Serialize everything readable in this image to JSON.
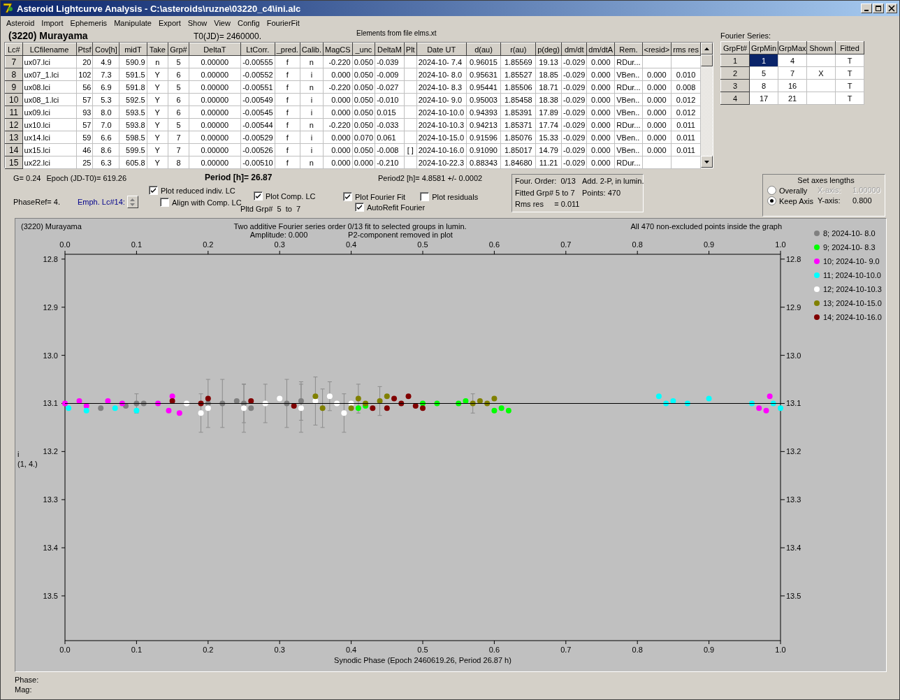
{
  "window": {
    "title": "Asteroid Lightcurve Analysis - C:\\asteroids\\ruzne\\03220_c4\\ini.alc"
  },
  "menu": [
    "Asteroid",
    "Import",
    "Ephemeris",
    "Manipulate",
    "Export",
    "Show",
    "View",
    "Config",
    "FourierFit"
  ],
  "header": {
    "asteroid": "(3220) Murayama",
    "t0": "T0(JD)= 2460000.",
    "elements": "Elements from file elms.xt"
  },
  "lc_table": {
    "columns": [
      "Lc#",
      "LCfilename",
      "Ptsf",
      "Cov[h]",
      "midT",
      "Take",
      "Grp#",
      "DeltaT",
      "LtCorr.",
      "_pred.",
      "Calib.",
      "MagCS",
      "_unc",
      "DeltaM",
      "Plt",
      "Date UT",
      "d(au)",
      "r(au)",
      "p(deg)",
      "dm/dt",
      "dm/dtA",
      "Rem.",
      "<resid>",
      "rms res"
    ],
    "rows": [
      {
        "cells": [
          "7",
          "ux07.lci",
          "20",
          "4.9",
          "590.9",
          "n",
          "5",
          "0.00000",
          "-0.00555",
          "f",
          "n",
          "-0.220",
          "0.050",
          "-0.039",
          null,
          "2024-10- 7.4",
          "0.96015",
          "1.85569",
          "19.13",
          "-0.029",
          "0.000",
          "RDur...",
          null,
          null
        ]
      },
      {
        "cells": [
          "8",
          "ux07_1.lci",
          "102",
          "7.3",
          "591.5",
          "Y",
          "6",
          "0.00000",
          "-0.00552",
          "f",
          "i",
          "0.000",
          "0.050",
          "-0.009",
          null,
          "2024-10- 8.0",
          "0.95631",
          "1.85527",
          "18.85",
          "-0.029",
          "0.000",
          "VBen..",
          "0.000",
          "0.010"
        ]
      },
      {
        "cells": [
          "9",
          "ux08.lci",
          "56",
          "6.9",
          "591.8",
          "Y",
          "5",
          "0.00000",
          "-0.00551",
          "f",
          "n",
          "-0.220",
          "0.050",
          "-0.027",
          null,
          "2024-10- 8.3",
          "0.95441",
          "1.85506",
          "18.71",
          "-0.029",
          "0.000",
          "RDur...",
          "0.000",
          "0.008"
        ]
      },
      {
        "cells": [
          "10",
          "ux08_1.lci",
          "57",
          "5.3",
          "592.5",
          "Y",
          "6",
          "0.00000",
          "-0.00549",
          "f",
          "i",
          "0.000",
          "0.050",
          "-0.010",
          null,
          "2024-10- 9.0",
          "0.95003",
          "1.85458",
          "18.38",
          "-0.029",
          "0.000",
          "VBen..",
          "0.000",
          "0.012"
        ]
      },
      {
        "cells": [
          "11",
          "ux09.lci",
          "93",
          "8.0",
          "593.5",
          "Y",
          "6",
          "0.00000",
          "-0.00545",
          "f",
          "i",
          "0.000",
          "0.050",
          "0.015",
          null,
          "2024-10-10.0",
          "0.94393",
          "1.85391",
          "17.89",
          "-0.029",
          "0.000",
          "VBen..",
          "0.000",
          "0.012"
        ]
      },
      {
        "cells": [
          "12",
          "ux10.lci",
          "57",
          "7.0",
          "593.8",
          "Y",
          "5",
          "0.00000",
          "-0.00544",
          "f",
          "n",
          "-0.220",
          "0.050",
          "-0.033",
          null,
          "2024-10-10.3",
          "0.94213",
          "1.85371",
          "17.74",
          "-0.029",
          "0.000",
          "RDur...",
          "0.000",
          "0.011"
        ]
      },
      {
        "cells": [
          "13",
          "ux14.lci",
          "59",
          "6.6",
          "598.5",
          "Y",
          "7",
          "0.00000",
          "-0.00529",
          "f",
          "i",
          "0.000",
          "0.070",
          "0.061",
          null,
          "2024-10-15.0",
          "0.91596",
          "1.85076",
          "15.33",
          "-0.029",
          "0.000",
          "VBen..",
          "0.000",
          "0.011"
        ]
      },
      {
        "cells": [
          "14",
          "ux15.lci",
          "46",
          "8.6",
          "599.5",
          "Y",
          "7",
          "0.00000",
          "-0.00526",
          "f",
          "i",
          "0.000",
          "0.050",
          "-0.008",
          "[ ]",
          "2024-10-16.0",
          "0.91090",
          "1.85017",
          "14.79",
          "-0.029",
          "0.000",
          "VBen..",
          "0.000",
          "0.011"
        ]
      },
      {
        "cells": [
          "15",
          "ux22.lci",
          "25",
          "6.3",
          "605.8",
          "Y",
          "8",
          "0.00000",
          "-0.00510",
          "f",
          "n",
          "0.000",
          "0.000",
          "-0.210",
          null,
          "2024-10-22.3",
          "0.88343",
          "1.84680",
          "11.21",
          "-0.029",
          "0.000",
          "RDur...",
          null,
          null
        ]
      }
    ]
  },
  "fourier": {
    "label": "Fourier Series:",
    "columns": [
      "GrpFt#",
      "GrpMin",
      "GrpMax",
      "Shown",
      "Fitted"
    ],
    "rows": [
      {
        "cells": [
          "1",
          "1",
          "4",
          null,
          "T"
        ],
        "selected": true
      },
      {
        "cells": [
          "2",
          "5",
          "7",
          "X",
          "T"
        ],
        "selected": false
      },
      {
        "cells": [
          "3",
          "8",
          "16",
          null,
          "T"
        ],
        "selected": false
      },
      {
        "cells": [
          "4",
          "17",
          "21",
          null,
          "T"
        ],
        "selected": false
      }
    ]
  },
  "info": {
    "g": "G= 0.24",
    "epoch": "Epoch (JD-T0)= 619.26",
    "phase_ref": "PhaseRef= 4.",
    "emph": "Emph. Lc#14:",
    "period": "Period [h]= 26.87",
    "period2": "Period2 [h]= 4.8581 +/- 0.0002",
    "plotted_groups": "Pltd Grp#  5  to  7"
  },
  "options": [
    {
      "label": "Plot reduced indiv. LC",
      "checked": true
    },
    {
      "label": "Align with Comp. LC",
      "checked": false
    },
    {
      "label": "Plot Comp. LC",
      "checked": true
    },
    {
      "label": "Plot Fourier Fit",
      "checked": true
    },
    {
      "label": "Plot residuals",
      "checked": false
    },
    {
      "label": "AutoRefit Fourier",
      "checked": true
    }
  ],
  "fit_summary": [
    "Four. Order:  0/13",
    "Add. 2-P, in lumin.",
    "Fitted Grp# 5 to 7",
    "Points: 470",
    "Rms res     = 0.011"
  ],
  "axes_lengths": {
    "title": "Set axes lengths",
    "modes": [
      {
        "label": "Overally",
        "selected": false
      },
      {
        "label": "Keep Axis",
        "selected": true
      }
    ],
    "fields": [
      {
        "label": "X-axis:",
        "value": "1.00000",
        "disabled": true
      },
      {
        "label": "Y-axis:",
        "value": "0.800",
        "disabled": false
      }
    ]
  },
  "plot": {
    "object": "(3220) Murayama",
    "subtitle": "Two additive Fourier series order 0/13 fit to selected groups in lumin.",
    "amplitude": "Amplitude: 0.000",
    "note": "P2-component removed in plot",
    "points_note": "All 470 non-excluded points inside the graph",
    "band": "i",
    "y_scale": "(1, 4.)",
    "chart_data": {
      "type": "scatter",
      "xlabel": "Synodic Phase (Epoch 2460619.26, Period 26.87 h)",
      "xlim": [
        0,
        1
      ],
      "ylim": [
        13.593,
        12.79
      ],
      "xticks": [
        {
          "value": 0,
          "label": "0.0"
        },
        {
          "value": 0.1,
          "label": "0.1"
        },
        {
          "value": 0.2,
          "label": "0.2"
        },
        {
          "value": 0.3,
          "label": "0.3"
        },
        {
          "value": 0.4,
          "label": "0.4"
        },
        {
          "value": 0.5,
          "label": "0.5"
        },
        {
          "value": 0.6,
          "label": "0.6"
        },
        {
          "value": 0.7,
          "label": "0.7"
        },
        {
          "value": 0.8,
          "label": "0.8"
        },
        {
          "value": 0.9,
          "label": "0.9"
        },
        {
          "value": 1,
          "label": "1.0"
        }
      ],
      "yticks": [
        {
          "value": 12.8,
          "label": "12.8"
        },
        {
          "value": 12.9,
          "label": "12.9"
        },
        {
          "value": 13,
          "label": "13.0"
        },
        {
          "value": 13.1,
          "label": "13.1"
        },
        {
          "value": 13.2,
          "label": "13.2"
        },
        {
          "value": 13.3,
          "label": "13.3"
        },
        {
          "value": 13.4,
          "label": "13.4"
        },
        {
          "value": 13.5,
          "label": "13.5"
        }
      ],
      "ref_lines": [
        {
          "axis": "y",
          "value": 13.1
        }
      ],
      "legend": "right",
      "series": [
        {
          "name": "8; 2024-10- 8.0",
          "color": "#808080",
          "x": [
            0.05,
            0.085,
            0.1,
            0.11,
            0.2,
            0.22,
            0.24,
            0.25,
            0.26,
            0.31,
            0.33
          ],
          "values": [
            13.11,
            13.105,
            13.1,
            13.1,
            13.1,
            13.1,
            13.095,
            13.1,
            13.11,
            13.1,
            13.095
          ],
          "errors": [
            null,
            null,
            0.02,
            null,
            0.05,
            0.05,
            null,
            0.04,
            null,
            0.05,
            0.04
          ]
        },
        {
          "name": "9; 2024-10- 8.3",
          "color": "#00ff00",
          "x": [
            0.41,
            0.42,
            0.5,
            0.52,
            0.55,
            0.56,
            0.6,
            0.61,
            0.62
          ],
          "values": [
            13.11,
            13.105,
            13.1,
            13.1,
            13.1,
            13.095,
            13.115,
            13.11,
            13.115
          ]
        },
        {
          "name": "10; 2024-10- 9.0",
          "color": "#ff00ff",
          "x": [
            0,
            0.02,
            0.03,
            0.06,
            0.08,
            0.13,
            0.145,
            0.15,
            0.16,
            0.97,
            0.98,
            0.985
          ],
          "values": [
            13.1,
            13.095,
            13.105,
            13.095,
            13.1,
            13.1,
            13.115,
            13.085,
            13.12,
            13.11,
            13.115,
            13.085
          ]
        },
        {
          "name": "11; 2024-10-10.0",
          "color": "#00ffff",
          "x": [
            0.005,
            0.03,
            0.07,
            0.1,
            0.83,
            0.84,
            0.85,
            0.87,
            0.9,
            0.96,
            0.99,
            1
          ],
          "values": [
            13.11,
            13.115,
            13.11,
            13.115,
            13.085,
            13.1,
            13.095,
            13.1,
            13.09,
            13.1,
            13.1,
            13.11
          ]
        },
        {
          "name": "12; 2024-10-10.3",
          "color": "#ffffff",
          "x": [
            0.17,
            0.19,
            0.2,
            0.25,
            0.28,
            0.3,
            0.33,
            0.35,
            0.37,
            0.38,
            0.39,
            0.4
          ],
          "values": [
            13.1,
            13.12,
            13.11,
            13.11,
            13.1,
            13.09,
            13.11,
            13.095,
            13.085,
            13.1,
            13.12,
            13.1
          ],
          "errors": [
            null,
            0.04,
            null,
            0.05,
            0.04,
            null,
            0.05,
            0.05,
            0.03,
            null,
            0.04,
            null
          ]
        },
        {
          "name": "13; 2024-10-15.0",
          "color": "#808000",
          "x": [
            0.35,
            0.36,
            0.4,
            0.41,
            0.42,
            0.44,
            0.45,
            0.57,
            0.58,
            0.59,
            0.6
          ],
          "values": [
            13.085,
            13.11,
            13.11,
            13.09,
            13.1,
            13.095,
            13.085,
            13.1,
            13.095,
            13.1,
            13.09
          ],
          "errors": [
            null,
            0.04,
            null,
            0.03,
            null,
            0.03,
            null,
            0.02,
            null,
            null,
            null
          ]
        },
        {
          "name": "14; 2024-10-16.0",
          "color": "#800000",
          "x": [
            0.15,
            0.19,
            0.2,
            0.26,
            0.32,
            0.43,
            0.45,
            0.46,
            0.47,
            0.48,
            0.49,
            0.5
          ],
          "values": [
            13.095,
            13.1,
            13.09,
            13.095,
            13.105,
            13.11,
            13.11,
            13.09,
            13.1,
            13.085,
            13.105,
            13.11
          ]
        }
      ]
    }
  },
  "status": [
    "Phase:",
    "Mag:"
  ]
}
